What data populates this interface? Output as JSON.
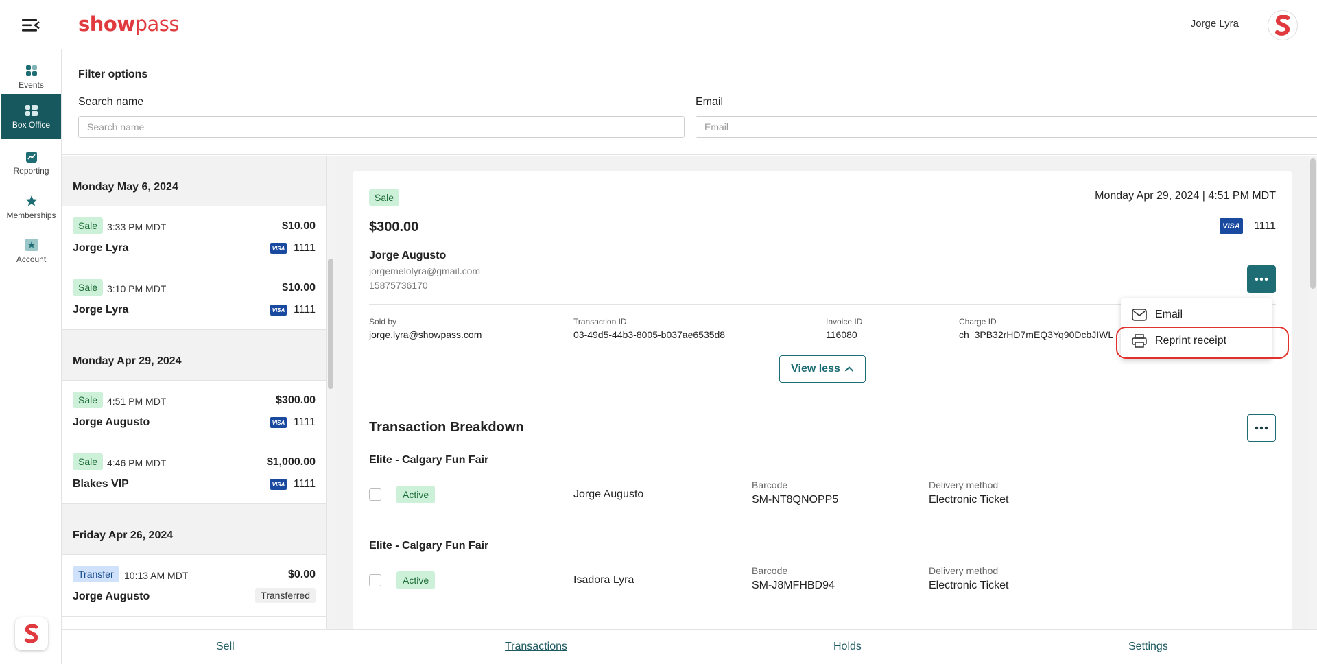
{
  "header": {
    "logo_text_bold": "show",
    "logo_text_light": "pass",
    "user_name": "Jorge Lyra"
  },
  "sidebar": {
    "items": [
      {
        "label": "Events",
        "icon": "grid-icon"
      },
      {
        "label": "Box Office",
        "icon": "box-office-icon"
      },
      {
        "label": "Reporting",
        "icon": "chart-icon"
      },
      {
        "label": "Memberships",
        "icon": "star-icon"
      },
      {
        "label": "Account",
        "icon": "account-icon"
      }
    ]
  },
  "filters": {
    "title": "Filter options",
    "name_label": "Search name",
    "name_placeholder": "Search name",
    "email_label": "Email",
    "email_placeholder": "Email"
  },
  "transactions_list": {
    "groups": [
      {
        "date": "Monday May 6, 2024",
        "items": [
          {
            "type": "Sale",
            "time": "3:33 PM MDT",
            "amount": "$10.00",
            "name": "Jorge Lyra",
            "card_last4": "1111"
          },
          {
            "type": "Sale",
            "time": "3:10 PM MDT",
            "amount": "$10.00",
            "name": "Jorge Lyra",
            "card_last4": "1111"
          }
        ]
      },
      {
        "date": "Monday Apr 29, 2024",
        "items": [
          {
            "type": "Sale",
            "time": "4:51 PM MDT",
            "amount": "$300.00",
            "name": "Jorge Augusto",
            "card_last4": "1111"
          },
          {
            "type": "Sale",
            "time": "4:46 PM MDT",
            "amount": "$1,000.00",
            "name": "Blakes VIP",
            "card_last4": "1111"
          }
        ]
      },
      {
        "date": "Friday Apr 26, 2024",
        "items": [
          {
            "type": "Transfer",
            "time": "10:13 AM MDT",
            "amount": "$0.00",
            "name": "Jorge Augusto",
            "status": "Transferred"
          }
        ]
      }
    ]
  },
  "detail": {
    "type": "Sale",
    "datetime": "Monday Apr 29, 2024 | 4:51 PM MDT",
    "amount": "$300.00",
    "card_brand": "VISA",
    "card_last4": "1111",
    "customer_name": "Jorge Augusto",
    "customer_email": "jorgemelolyra@gmail.com",
    "customer_phone": "15875736170",
    "sold_by_label": "Sold by",
    "sold_by": "jorge.lyra@showpass.com",
    "transaction_id_label": "Transaction ID",
    "transaction_id": "03-49d5-44b3-8005-b037ae6535d8",
    "invoice_id_label": "Invoice ID",
    "invoice_id": "116080",
    "charge_id_label": "Charge ID",
    "charge_id": "ch_3PB32rHD7mEQ3Yq90DcbJIWL",
    "view_less_label": "View less",
    "menu": {
      "email_label": "Email",
      "reprint_label": "Reprint receipt"
    }
  },
  "breakdown": {
    "title": "Transaction Breakdown",
    "items": [
      {
        "event": "Elite - Calgary Fun Fair",
        "status": "Active",
        "holder": "Jorge Augusto",
        "barcode_label": "Barcode",
        "barcode": "SM-NT8QNOPP5",
        "delivery_label": "Delivery method",
        "delivery": "Electronic Ticket"
      },
      {
        "event": "Elite - Calgary Fun Fair",
        "status": "Active",
        "holder": "Isadora Lyra",
        "barcode_label": "Barcode",
        "barcode": "SM-J8MFHBD94",
        "delivery_label": "Delivery method",
        "delivery": "Electronic Ticket"
      }
    ]
  },
  "bottom_nav": {
    "sell": "Sell",
    "transactions": "Transactions",
    "holds": "Holds",
    "settings": "Settings"
  },
  "colors": {
    "brand_red": "#e0393e",
    "teal": "#1e6c74",
    "sidebar_active": "#17585f",
    "sale_badge_bg": "#ccf0d8",
    "transfer_badge_bg": "#cfe1fb",
    "highlight": "#e0312c"
  }
}
